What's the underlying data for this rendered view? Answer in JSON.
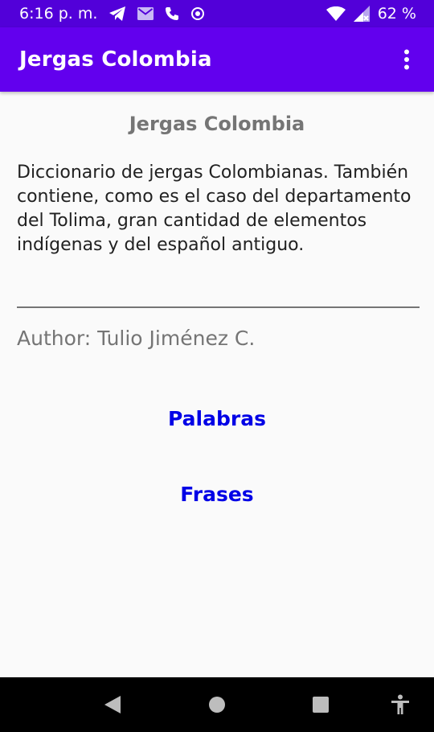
{
  "status_bar": {
    "time": "6:16 p. m.",
    "battery": "62 %",
    "icons": [
      "telegram-icon",
      "mail-icon",
      "phone-icon",
      "radio-icon",
      "wifi-icon",
      "signal-icon"
    ]
  },
  "app_bar": {
    "title": "Jergas Colombia",
    "overflow_icon": "more-vert-icon"
  },
  "main": {
    "title": "Jergas Colombia",
    "description": "Diccionario de jergas Colombianas. También contiene, como es el caso del departamento del Tolima, gran cantidad de elementos indígenas y del español antiguo.",
    "author": "Author: Tulio Jiménez C.",
    "links": {
      "words": "Palabras",
      "phrases": "Frases"
    }
  },
  "nav_bar": {
    "icons": [
      "back-icon",
      "home-icon",
      "recents-icon",
      "accessibility-icon"
    ]
  },
  "colors": {
    "status_bar": "#5200d9",
    "app_bar": "#6200ee",
    "link": "#0000e6",
    "title_gray": "#757575",
    "text": "#212121",
    "background": "#fafafa"
  }
}
